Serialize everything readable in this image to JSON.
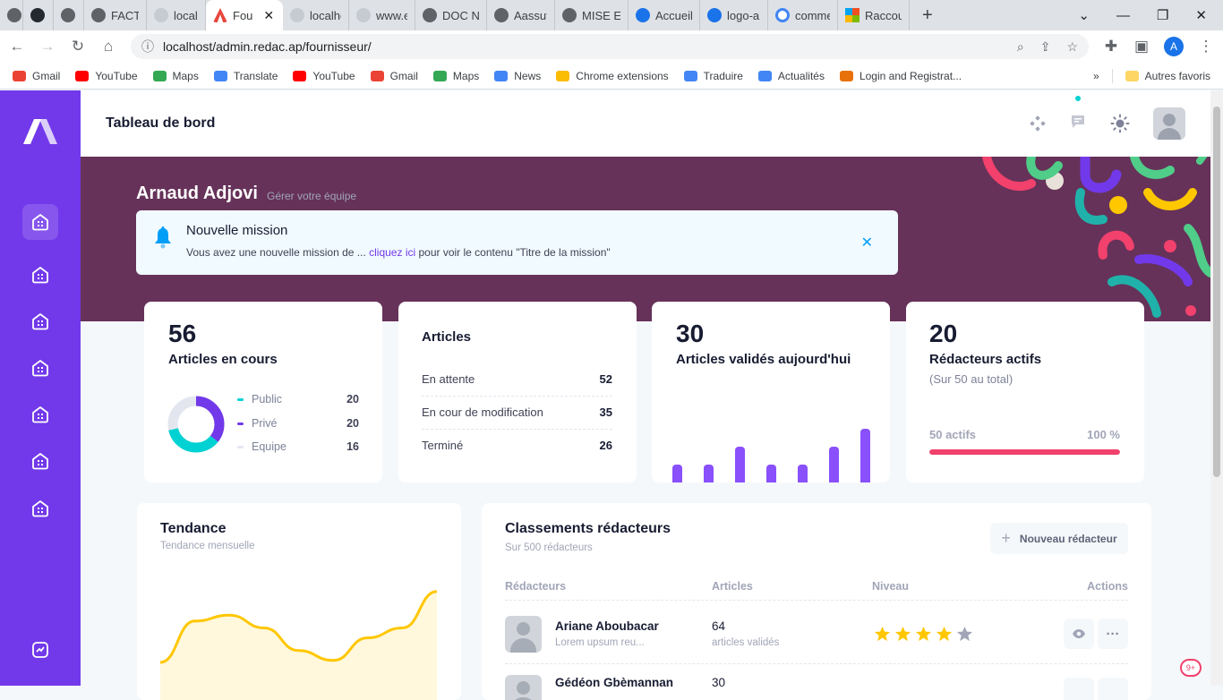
{
  "browser": {
    "tabs": [
      {
        "label": "",
        "icon": "globe-icon"
      },
      {
        "label": "",
        "icon": "github-icon"
      },
      {
        "label": "",
        "icon": "hexagon-icon"
      },
      {
        "label": "FACTUR",
        "icon": "globe-icon"
      },
      {
        "label": "localhost",
        "icon": "pma-icon"
      },
      {
        "label": "Fou",
        "icon": "redac-logo-icon"
      },
      {
        "label": "localhost",
        "icon": "page-icon"
      },
      {
        "label": "www.el",
        "icon": "page-icon"
      },
      {
        "label": "DOC N",
        "icon": "globe-icon"
      },
      {
        "label": "Aassuf",
        "icon": "globe-icon"
      },
      {
        "label": "MISE E",
        "icon": "globe-icon"
      },
      {
        "label": "Accueil",
        "icon": "canva-icon"
      },
      {
        "label": "logo-ap",
        "icon": "canva-icon"
      },
      {
        "label": "comme",
        "icon": "google-icon"
      },
      {
        "label": "Raccou",
        "icon": "microsoft-icon"
      }
    ],
    "new_tab": "+",
    "url": "localhost/admin.redac.ap/fournisseur/",
    "profile_initial": "A",
    "bookmarks": [
      {
        "label": "Gmail",
        "color": "#ea4335"
      },
      {
        "label": "YouTube",
        "color": "#ff0000"
      },
      {
        "label": "Maps",
        "color": "#34a853"
      },
      {
        "label": "Translate",
        "color": "#4285f4"
      },
      {
        "label": "YouTube",
        "color": "#ff0000"
      },
      {
        "label": "Gmail",
        "color": "#ea4335"
      },
      {
        "label": "Maps",
        "color": "#34a853"
      },
      {
        "label": "News",
        "color": "#4285f4"
      },
      {
        "label": "Chrome extensions",
        "color": "#fbbc04"
      },
      {
        "label": "Traduire",
        "color": "#4285f4"
      },
      {
        "label": "Actualités",
        "color": "#4285f4"
      },
      {
        "label": "Login and Registrat...",
        "color": "#e8710a"
      }
    ],
    "bookmarks_more": "»",
    "other_bookmarks": "Autres favoris"
  },
  "topbar": {
    "title": "Tableau de bord"
  },
  "hero": {
    "name": "Arnaud Adjovi",
    "subtitle": "Gérer votre équipe",
    "alert": {
      "title": "Nouvelle mission",
      "text_before": "Vous avez une nouvelle mission de ... ",
      "link": "cliquez ici",
      "text_after": " pour voir le contenu \"Titre de la mission\""
    }
  },
  "stats": {
    "articles_en_cours": {
      "value": "56",
      "label": "Articles en cours",
      "legend": [
        {
          "label": "Public",
          "value": "20",
          "color": "#00d2d3"
        },
        {
          "label": "Privé",
          "value": "20",
          "color": "#7239ea"
        },
        {
          "label": "Equipe",
          "value": "16",
          "color": "#e4e6ef"
        }
      ]
    },
    "articles": {
      "title": "Articles",
      "rows": [
        {
          "label": "En attente",
          "value": "52"
        },
        {
          "label": "En cour de modification",
          "value": "35"
        },
        {
          "label": "Terminé",
          "value": "26"
        }
      ]
    },
    "valides": {
      "value": "30",
      "label": "Articles validés aujourd'hui",
      "bars": [
        2,
        2,
        4,
        2,
        2,
        4,
        6
      ]
    },
    "redacteurs": {
      "value": "20",
      "label": "Rédacteurs actifs",
      "sub": "(Sur 50 au total)",
      "progress_label": "50 actifs",
      "progress_pct": "100 %",
      "progress": 1.0
    }
  },
  "tendance": {
    "title": "Tendance",
    "subtitle": "Tendance mensuelle",
    "color": "#ffc700",
    "values": [
      0.2,
      0.62,
      0.68,
      0.55,
      0.32,
      0.22,
      0.45,
      0.55,
      0.92
    ]
  },
  "classements": {
    "title": "Classements rédacteurs",
    "subtitle": "Sur 500 rédacteurs",
    "add_button": "Nouveau rédacteur",
    "columns": [
      "Rédacteurs",
      "Articles",
      "Niveau",
      "Actions"
    ],
    "rows": [
      {
        "name": "Ariane Aboubacar",
        "desc": "Lorem upsum reu...",
        "articles": "64",
        "articles_sub": "articles validés",
        "stars": 4
      },
      {
        "name": "Gédéon Gbèmannan",
        "desc": "",
        "articles": "30",
        "articles_sub": "",
        "stars": 0
      }
    ]
  }
}
